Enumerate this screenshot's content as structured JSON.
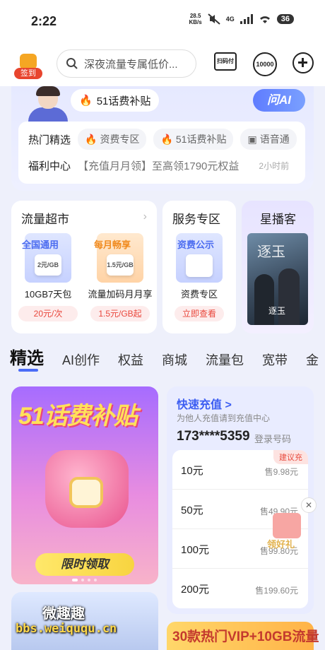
{
  "status": {
    "time": "2:22",
    "speed_top": "28.5",
    "speed_bottom": "KB/s",
    "network": "4G",
    "battery": "36"
  },
  "header": {
    "checkin_label": "签到",
    "search_placeholder": "深夜流量专属低价...",
    "scan_label": "扫码付",
    "tenk_label": "10000"
  },
  "service": {
    "subsidy_label": "51话费补贴",
    "ask_ai_label": "问AI",
    "hot_label": "热门精选",
    "hot_chips": [
      "资费专区",
      "51话费补贴",
      "语音通"
    ],
    "welfare_label": "福利中心",
    "welfare_desc": "【充值月月领】至高领1790元权益",
    "welfare_time": "2小时前"
  },
  "cards": {
    "market_title": "流量超市",
    "product1": {
      "tag": "全国通用",
      "stack": "2元/GB",
      "name": "10GB7天包",
      "price": "20元/次"
    },
    "product2": {
      "tag": "每月畅享",
      "stack": "1.5元/GB",
      "name": "流量加码月月享",
      "price": "1.5元/GB起"
    },
    "service_title": "服务专区",
    "service_tag": "资费公示",
    "service_name": "资费专区",
    "service_action": "立即查看",
    "live_title": "星播客",
    "poster_calli": "逐玉",
    "poster_title": "逐玉"
  },
  "tabs": [
    "精选",
    "AI创作",
    "权益",
    "商城",
    "流量包",
    "宽带",
    "金"
  ],
  "banner": {
    "title": "51话费补贴",
    "button": "限时领取"
  },
  "recharge": {
    "title": "快速充值 >",
    "subtitle": "为他人充值请到充值中心",
    "phone": "173****5359",
    "login": "登录号码",
    "badge": "建议充",
    "items": [
      {
        "amount": "10元",
        "price": "售9.98元"
      },
      {
        "amount": "50元",
        "price": "售49.90元"
      },
      {
        "amount": "100元",
        "price": "售99.80元"
      },
      {
        "amount": "200元",
        "price": "售199.60元"
      }
    ]
  },
  "float": {
    "gift_label": "领好礼",
    "close": "✕"
  },
  "bottom": {
    "right_text": "30款热门VIP+10GB流量"
  },
  "watermark": {
    "line1": "微趣趣",
    "line2": "bbs.weiququ.cn"
  },
  "colors": {
    "accent": "#4a6cf7",
    "price_red": "#e9473c",
    "banner_yellow": "#ffe15a"
  }
}
